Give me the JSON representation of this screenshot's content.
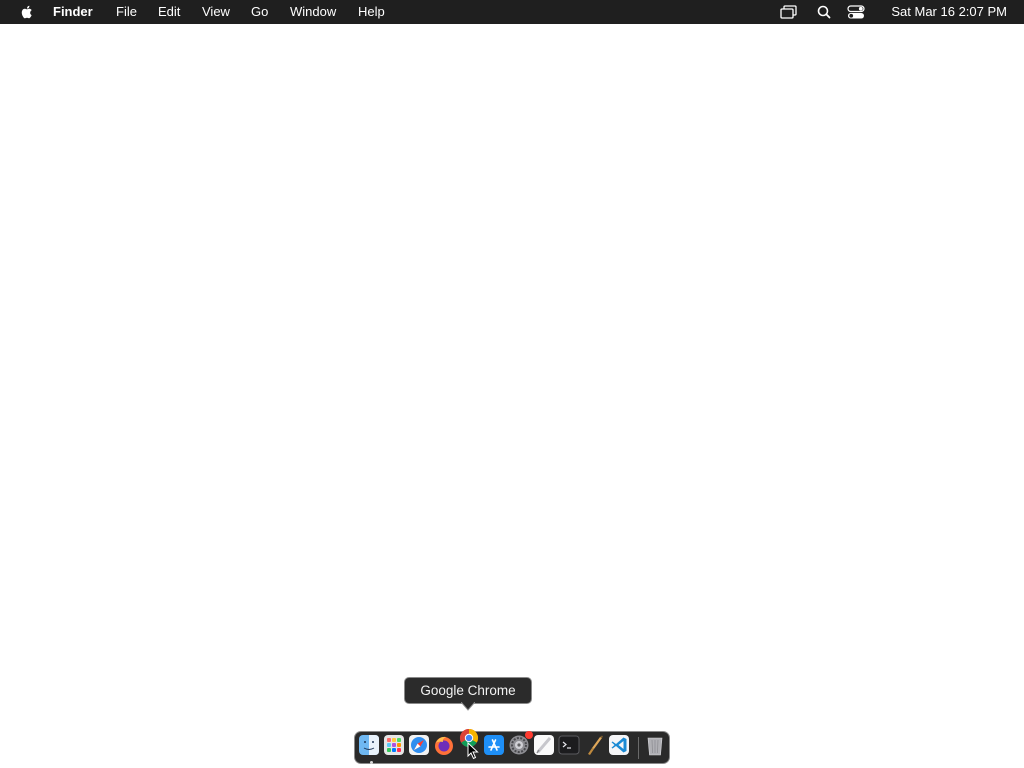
{
  "menubar": {
    "app_name": "Finder",
    "items": [
      {
        "label": "File"
      },
      {
        "label": "Edit"
      },
      {
        "label": "View"
      },
      {
        "label": "Go"
      },
      {
        "label": "Window"
      },
      {
        "label": "Help"
      }
    ],
    "status_icons": [
      "screen-mirroring-icon",
      "search-icon",
      "control-center-icon"
    ],
    "datetime": "Sat Mar 16  2:07 PM"
  },
  "tooltip": {
    "text": "Google Chrome"
  },
  "dock": {
    "apps": [
      {
        "name": "Finder",
        "icon": "finder-icon",
        "running": true
      },
      {
        "name": "Launchpad",
        "icon": "launchpad-icon",
        "running": false
      },
      {
        "name": "Safari",
        "icon": "safari-icon",
        "running": false
      },
      {
        "name": "Firefox",
        "icon": "firefox-icon",
        "running": false
      },
      {
        "name": "Google Chrome",
        "icon": "chrome-icon",
        "running": false,
        "hovered": true
      },
      {
        "name": "App Store",
        "icon": "app-store-icon",
        "running": false
      },
      {
        "name": "System Settings",
        "icon": "system-settings-icon",
        "running": false,
        "badge": true
      },
      {
        "name": "Notes",
        "icon": "notes-icon",
        "running": false
      },
      {
        "name": "Terminal",
        "icon": "terminal-icon",
        "running": false
      },
      {
        "name": "Script Editor",
        "icon": "script-editor-icon",
        "running": false
      },
      {
        "name": "Visual Studio Code",
        "icon": "vscode-icon",
        "running": false
      },
      {
        "name": "Trash",
        "icon": "trash-icon",
        "running": false
      }
    ]
  },
  "colors": {
    "menubar_bg": "#1f1f1f",
    "desktop_bg": "#ffffff",
    "dock_bg": "#2a2a2a",
    "tooltip_bg": "#2b2b2b"
  }
}
